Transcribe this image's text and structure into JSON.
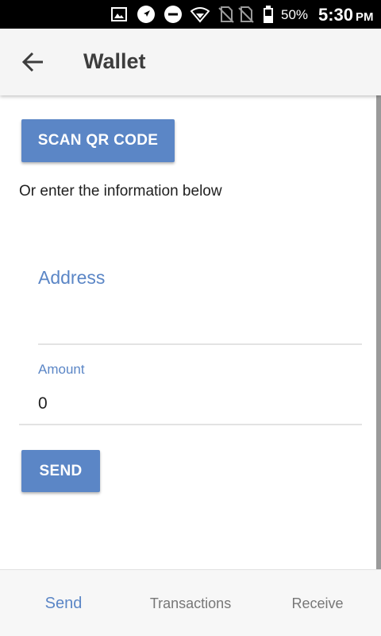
{
  "status_bar": {
    "battery_percent": "50%",
    "time": "5:30",
    "ampm": "PM",
    "icons": [
      "image-icon",
      "navigation-icon",
      "do-not-disturb-icon",
      "wifi-icon",
      "no-sim-icon",
      "no-sim-icon",
      "battery-icon"
    ]
  },
  "app_bar": {
    "back_icon": "arrow-left-icon",
    "title": "Wallet"
  },
  "main": {
    "scan_button_label": "SCAN QR CODE",
    "instructions": "Or enter the information below",
    "address_hint": "Address",
    "amount_label": "Amount",
    "amount_value": "0",
    "send_button_label": "SEND"
  },
  "bottom_nav": {
    "tabs": [
      {
        "label": "Send",
        "active": true
      },
      {
        "label": "Transactions",
        "active": false
      },
      {
        "label": "Receive",
        "active": false
      }
    ]
  },
  "colors": {
    "accent": "#5b86c6",
    "status_bar_bg": "#000000",
    "app_bar_bg": "#f5f5f5",
    "title_text": "#3d3d3d",
    "inactive_tab_text": "#777777"
  }
}
